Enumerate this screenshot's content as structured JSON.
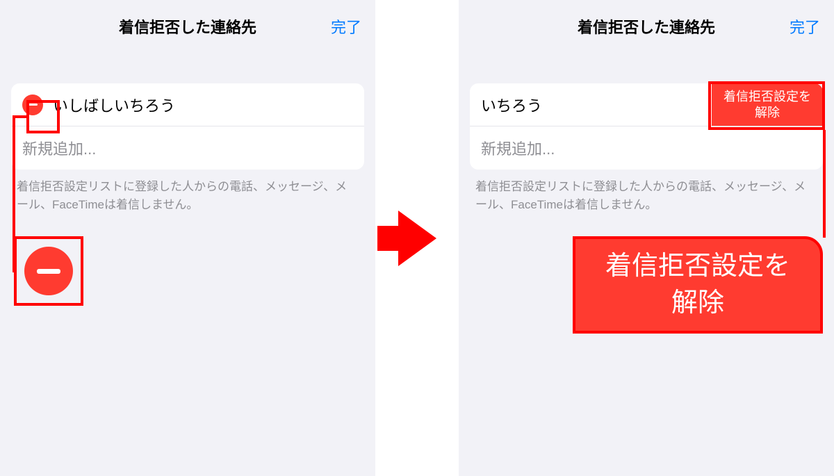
{
  "left": {
    "header": {
      "title": "着信拒否した連絡先",
      "done": "完了"
    },
    "contact": {
      "name": "いしばしいちろう"
    },
    "addNew": "新規追加...",
    "footer": "着信拒否設定リストに登録した人からの電話、メッセージ、メール、FaceTimeは着信しません。"
  },
  "right": {
    "header": {
      "title": "着信拒否した連絡先",
      "done": "完了"
    },
    "contact": {
      "name": "いちろう"
    },
    "unblockLabel": "着信拒否設定を\n解除",
    "addNew": "新規追加...",
    "footer": "着信拒否設定リストに登録した人からの電話、メッセージ、メール、FaceTimeは着信しません。",
    "bigUnblock": "着信拒否設定を\n解除"
  }
}
